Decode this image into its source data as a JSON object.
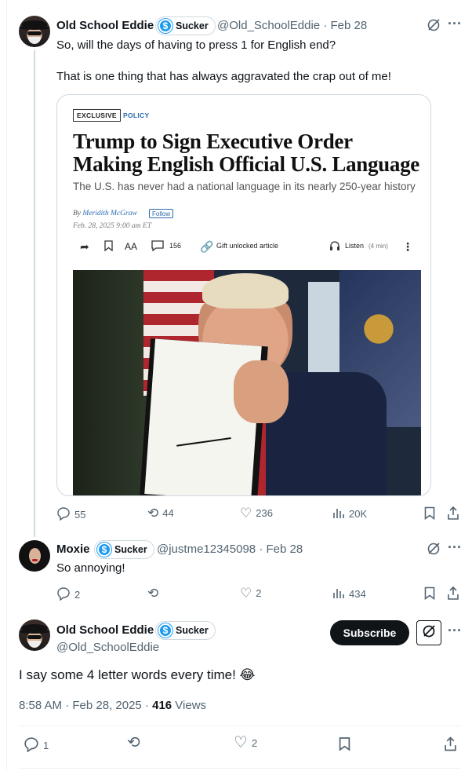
{
  "tweet1": {
    "name": "Old School Eddie",
    "badge": "Sucker",
    "handle_date": "@Old_SchoolEddie · Feb 28",
    "line1": "So, will the days of having to press 1 for English end?",
    "line2": "That is one thing that has always aggravated the crap out of me!",
    "stats": {
      "replies": "55",
      "retweets": "44",
      "likes": "236",
      "views": "20K"
    }
  },
  "article": {
    "tag_exclusive": "EXCLUSIVE",
    "tag_policy": "POLICY",
    "headline": "Trump to Sign Executive Order Making English Official U.S. Language",
    "dek": "The U.S. has never had a national language in its nearly 250-year history",
    "by_prefix": "By ",
    "author": "Meridith McGraw",
    "follow": "Follow",
    "date": "Feb. 28, 2025 9:00 am ET",
    "text_size": "AA",
    "comments": "156",
    "gift": "Gift unlocked article",
    "listen": "Listen",
    "listen_duration": "(4 min)"
  },
  "tweet2": {
    "name": "Moxie",
    "badge": "Sucker",
    "handle_date": "@justme12345098 · Feb 28",
    "text": "So annoying!",
    "stats": {
      "replies": "2",
      "likes": "2",
      "views": "434"
    }
  },
  "tweet3": {
    "name": "Old School Eddie",
    "badge": "Sucker",
    "handle": "@Old_SchoolEddie",
    "subscribe": "Subscribe",
    "text": "I say some 4 letter words every time!  😂",
    "timestamp": "8:58 AM · Feb 28, 2025 · ",
    "views_count": "416",
    "views_label": " Views",
    "stats": {
      "replies": "1",
      "likes": "2"
    }
  },
  "icons": {
    "reply": "reply-icon",
    "retweet": "retweet-icon",
    "like": "heart-icon",
    "views": "views-icon",
    "bookmark": "bookmark-icon",
    "share": "share-icon",
    "grok": "grok-icon",
    "more": "more-icon"
  },
  "colors": {
    "accent": "#1d9bf0",
    "text": "#0f1419",
    "muted": "#536471"
  }
}
